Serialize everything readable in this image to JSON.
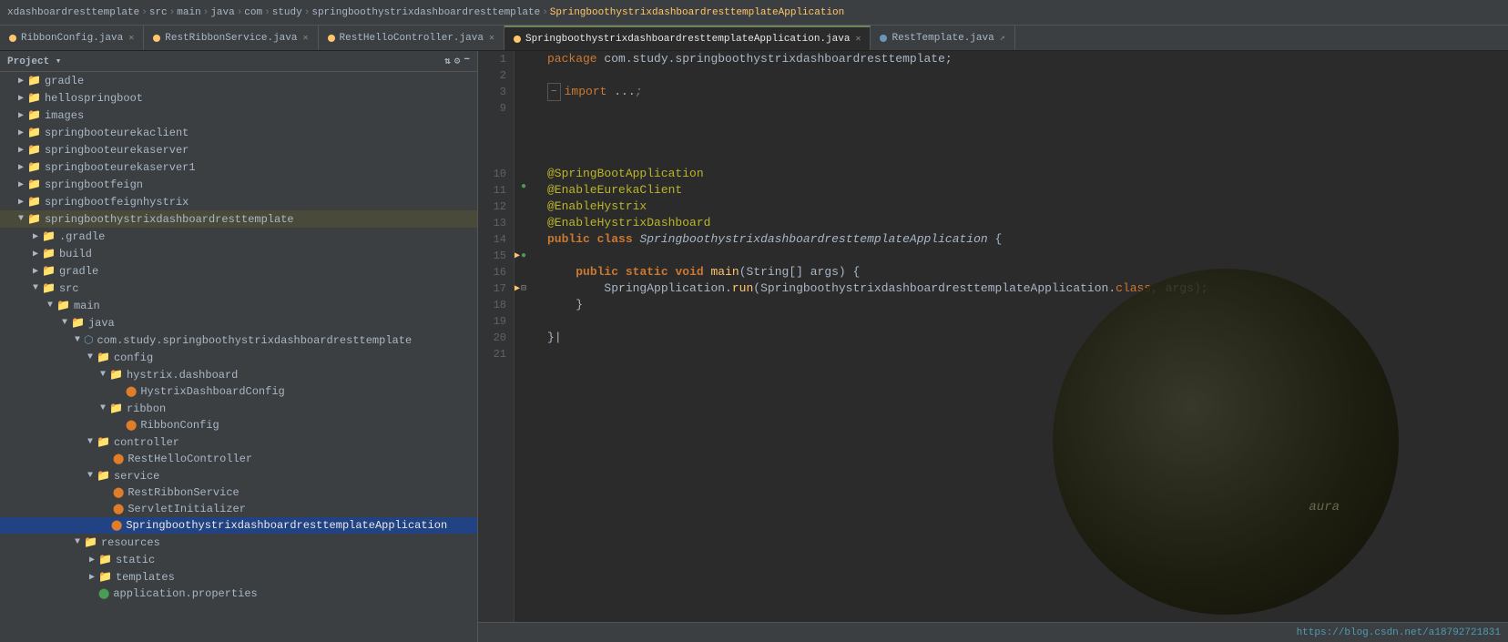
{
  "breadcrumb": {
    "items": [
      {
        "label": "xdashboardresttemplate",
        "type": "folder"
      },
      {
        "label": "src",
        "type": "folder"
      },
      {
        "label": "main",
        "type": "folder"
      },
      {
        "label": "java",
        "type": "folder"
      },
      {
        "label": "com",
        "type": "folder"
      },
      {
        "label": "study",
        "type": "folder"
      },
      {
        "label": "springboothystrixdashboardresttemplate",
        "type": "folder"
      },
      {
        "label": "SpringboothystrixdashboardresttemplateApplication",
        "type": "class",
        "active": true
      }
    ]
  },
  "tabs": [
    {
      "label": "RibbonConfig.java",
      "dot": "orange",
      "active": false,
      "closable": true
    },
    {
      "label": "RestRibbonService.java",
      "dot": "orange",
      "active": false,
      "closable": true
    },
    {
      "label": "RestHelloController.java",
      "dot": "orange",
      "active": false,
      "closable": true
    },
    {
      "label": "SpringboothystrixdashboardresttemplateApplication.java",
      "dot": "orange",
      "active": true,
      "closable": true
    },
    {
      "label": "RestTemplate.java",
      "dot": "blue",
      "active": false,
      "closable": false
    }
  ],
  "sidebar": {
    "title": "Project",
    "tree": [
      {
        "id": "gradle",
        "label": "gradle",
        "type": "folder",
        "indent": 1,
        "expanded": false
      },
      {
        "id": "hellospringboot",
        "label": "hellospringboot",
        "type": "folder",
        "indent": 1,
        "expanded": false
      },
      {
        "id": "images",
        "label": "images",
        "type": "folder",
        "indent": 1,
        "expanded": false
      },
      {
        "id": "springbooteurekaclient",
        "label": "springbooteurekaclient",
        "type": "folder",
        "indent": 1,
        "expanded": false
      },
      {
        "id": "springbooteurekaserver",
        "label": "springbooteurekaserver",
        "type": "folder",
        "indent": 1,
        "expanded": false
      },
      {
        "id": "springbooteurekaserver1",
        "label": "springbooteurekaserver1",
        "type": "folder",
        "indent": 1,
        "expanded": false
      },
      {
        "id": "springbootfeign",
        "label": "springbootfeign",
        "type": "folder",
        "indent": 1,
        "expanded": false
      },
      {
        "id": "springbootfeignhystrix",
        "label": "springbootfeignhystrix",
        "type": "folder",
        "indent": 1,
        "expanded": false
      },
      {
        "id": "springboothystrixdashboardresttemplate",
        "label": "springboothystrixdashboardresttemplate",
        "type": "folder",
        "indent": 1,
        "expanded": true
      },
      {
        "id": "dotgradle",
        "label": ".gradle",
        "type": "folder",
        "indent": 2,
        "expanded": false
      },
      {
        "id": "build",
        "label": "build",
        "type": "folder",
        "indent": 2,
        "expanded": false
      },
      {
        "id": "gradle2",
        "label": "gradle",
        "type": "folder",
        "indent": 2,
        "expanded": false
      },
      {
        "id": "src",
        "label": "src",
        "type": "folder",
        "indent": 2,
        "expanded": true
      },
      {
        "id": "main",
        "label": "main",
        "type": "folder",
        "indent": 3,
        "expanded": true
      },
      {
        "id": "java",
        "label": "java",
        "type": "folder",
        "indent": 4,
        "expanded": true
      },
      {
        "id": "package",
        "label": "com.study.springboothystrixdashboardresttemplate",
        "type": "package",
        "indent": 5,
        "expanded": true
      },
      {
        "id": "config",
        "label": "config",
        "type": "folder",
        "indent": 6,
        "expanded": true
      },
      {
        "id": "hystrix.dashboard",
        "label": "hystrix.dashboard",
        "type": "folder",
        "indent": 7,
        "expanded": true
      },
      {
        "id": "HystrixDashboardConfig",
        "label": "HystrixDashboardConfig",
        "type": "class-orange",
        "indent": 8
      },
      {
        "id": "ribbon",
        "label": "ribbon",
        "type": "folder",
        "indent": 7,
        "expanded": true
      },
      {
        "id": "RibbonConfig",
        "label": "RibbonConfig",
        "type": "class-orange",
        "indent": 8
      },
      {
        "id": "controller",
        "label": "controller",
        "type": "folder",
        "indent": 6,
        "expanded": true
      },
      {
        "id": "RestHelloController",
        "label": "RestHelloController",
        "type": "class-orange",
        "indent": 7
      },
      {
        "id": "service",
        "label": "service",
        "type": "folder",
        "indent": 6,
        "expanded": true
      },
      {
        "id": "RestRibbonService",
        "label": "RestRibbonService",
        "type": "class-orange",
        "indent": 7
      },
      {
        "id": "ServletInitializer",
        "label": "ServletInitializer",
        "type": "class-orange",
        "indent": 7
      },
      {
        "id": "SpringboothystrixApp",
        "label": "SpringboothystrixdashboardresttemplateApplication",
        "type": "class-orange-selected",
        "indent": 7
      },
      {
        "id": "resources",
        "label": "resources",
        "type": "folder",
        "indent": 5,
        "expanded": true
      },
      {
        "id": "static",
        "label": "static",
        "type": "folder",
        "indent": 6,
        "expanded": false
      },
      {
        "id": "templates",
        "label": "templates",
        "type": "folder",
        "indent": 6,
        "expanded": false
      },
      {
        "id": "application.properties",
        "label": "application.properties",
        "type": "file-green",
        "indent": 6
      }
    ]
  },
  "code": {
    "lines": [
      {
        "num": 1,
        "content": "package com.study.springboothystrixdashboardresttemplate;",
        "type": "package"
      },
      {
        "num": 2,
        "content": "",
        "type": "blank"
      },
      {
        "num": 3,
        "content": "import ...;",
        "type": "import-collapsed"
      },
      {
        "num": 9,
        "content": "",
        "type": "blank"
      },
      {
        "num": 10,
        "content": "@SpringBootApplication",
        "type": "annotation",
        "gutter": "run"
      },
      {
        "num": 11,
        "content": "@EnableEurekaClient",
        "type": "annotation"
      },
      {
        "num": 12,
        "content": "@EnableHystrix",
        "type": "annotation"
      },
      {
        "num": 13,
        "content": "@EnableHystrixDashboard",
        "type": "annotation"
      },
      {
        "num": 14,
        "content": "public class SpringboothystrixdashboardresttemplateApplication {",
        "type": "class-decl",
        "gutter": "run2"
      },
      {
        "num": 15,
        "content": "",
        "type": "blank"
      },
      {
        "num": 16,
        "content": "    public static void main(String[] args) {",
        "type": "method",
        "gutter": "run3"
      },
      {
        "num": 17,
        "content": "        SpringApplication.run(SpringboothystrixdashboardresttemplateApplication.class, args);",
        "type": "code"
      },
      {
        "num": 18,
        "content": "    }",
        "type": "code"
      },
      {
        "num": 19,
        "content": "",
        "type": "blank"
      },
      {
        "num": 20,
        "content": "}",
        "type": "closing"
      },
      {
        "num": 21,
        "content": "",
        "type": "blank"
      }
    ]
  },
  "statusbar": {
    "url": "https://blog.csdn.net/a18792721831"
  }
}
